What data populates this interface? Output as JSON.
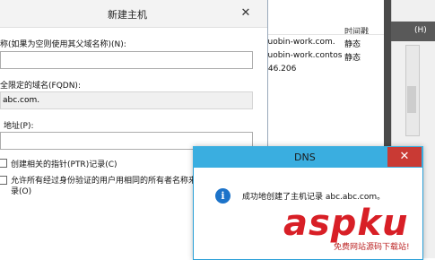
{
  "background_table": {
    "header_timestamp": "时间戳",
    "rows": [
      {
        "name": "luobin-work.com.",
        "status": "静态"
      },
      {
        "name": "luobin-work.contos",
        "status": "静态"
      },
      {
        "name": ".46.206",
        "status": ""
      }
    ]
  },
  "right_panel": {
    "header_text": "(H)"
  },
  "new_host_dialog": {
    "title": "新建主机",
    "close_glyph": "✕",
    "name_label": "称(如果为空则使用其父域名称)(N):",
    "name_value": "",
    "fqdn_label": "全限定的域名(FQDN):",
    "fqdn_value": "abc.com.",
    "ip_label": "地址(P):",
    "ptr_checkbox_label": "创建相关的指针(PTR)记录(C)",
    "allow_checkbox_label_line1": "允许所有经过身份验证的用户用相同的所有者名称来",
    "allow_checkbox_label_line2": "录(O)"
  },
  "dns_popup": {
    "title": "DNS",
    "close_glyph": "✕",
    "icon_glyph": "i",
    "message": "成功地创建了主机记录 abc.abc.com。"
  },
  "watermark": {
    "logo": "aspku",
    "subtitle": "免费网站源码下载站!"
  }
}
